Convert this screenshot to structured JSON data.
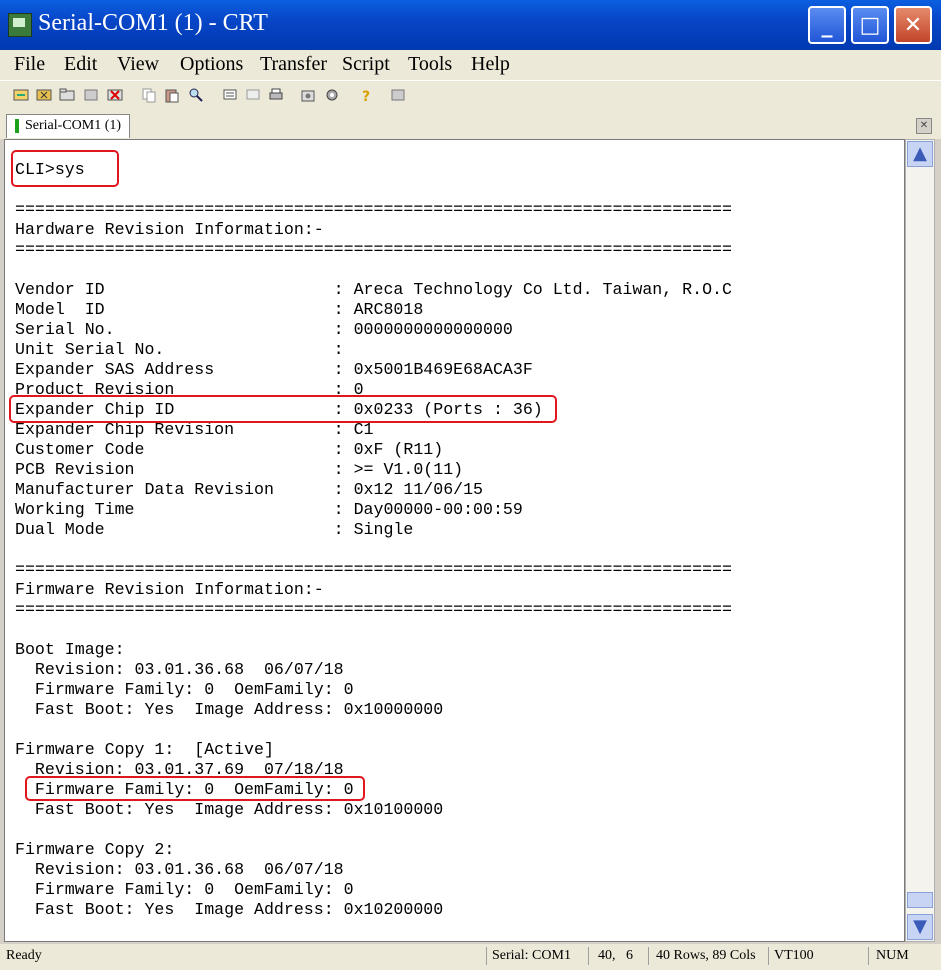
{
  "window": {
    "title": "Serial-COM1 (1) - CRT"
  },
  "menu": [
    "File",
    "Edit",
    "View",
    "Options",
    "Transfer",
    "Script",
    "Tools",
    "Help"
  ],
  "tab": {
    "label": "Serial-COM1 (1)"
  },
  "terminal": {
    "lines": [
      "CLI>sys",
      "",
      "========================================================================",
      "Hardware Revision Information:-",
      "========================================================================",
      "",
      "Vendor ID                       : Areca Technology Co Ltd. Taiwan, R.O.C",
      "Model  ID                       : ARC8018",
      "Serial No.                      : 0000000000000000",
      "Unit Serial No.                 :",
      "Expander SAS Address            : 0x5001B469E68ACA3F",
      "Product Revision                : 0",
      "Expander Chip ID                : 0x0233 (Ports : 36)",
      "Expander Chip Revision          : C1",
      "Customer Code                   : 0xF (R11)",
      "PCB Revision                    : >= V1.0(11)",
      "Manufacturer Data Revision      : 0x12 11/06/15",
      "Working Time                    : Day00000-00:00:59",
      "Dual Mode                       : Single",
      "",
      "========================================================================",
      "Firmware Revision Information:-",
      "========================================================================",
      "",
      "Boot Image:",
      "  Revision: 03.01.36.68  06/07/18",
      "  Firmware Family: 0  OemFamily: 0",
      "  Fast Boot: Yes  Image Address: 0x10000000",
      "",
      "Firmware Copy 1:  [Active]",
      "  Revision: 03.01.37.69  07/18/18",
      "  Firmware Family: 0  OemFamily: 0",
      "  Fast Boot: Yes  Image Address: 0x10100000",
      "",
      "Firmware Copy 2:",
      "  Revision: 03.01.36.68  06/07/18",
      "  Firmware Family: 0  OemFamily: 0",
      "  Fast Boot: Yes  Image Address: 0x10200000"
    ]
  },
  "status": {
    "ready": "Ready",
    "connection": "Serial: COM1",
    "cursor": "40,   6",
    "size": "40 Rows, 89 Cols",
    "emulation": "VT100",
    "num": "NUM"
  },
  "colors": {
    "highlight_box": "#e0171e",
    "titlebar": "#0846c8"
  }
}
